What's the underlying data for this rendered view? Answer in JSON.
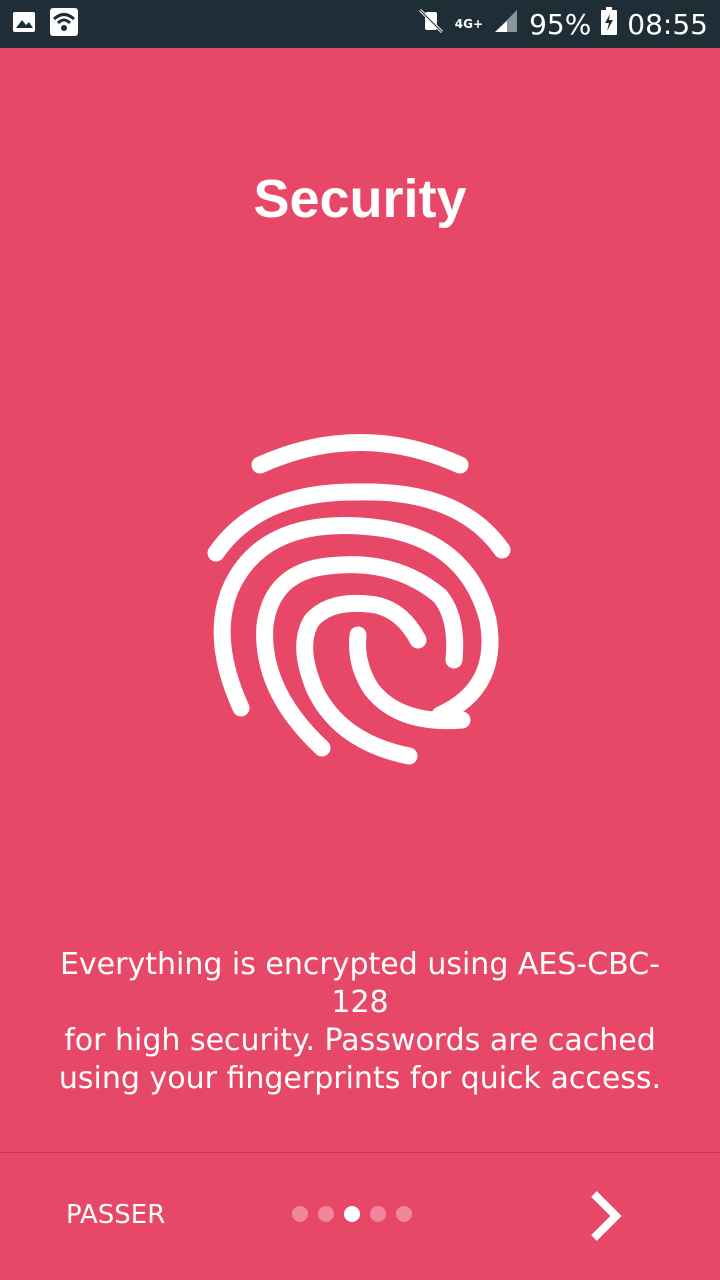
{
  "status_bar": {
    "battery_percent": "95%",
    "time": "08:55",
    "network_type": "4G+",
    "left_icons": [
      "gallery-icon",
      "wifi-icon"
    ],
    "right_icons": [
      "mute-vibrate-icon",
      "signal-icon",
      "battery-icon"
    ]
  },
  "onboarding": {
    "title": "Security",
    "illustration": "fingerprint-icon",
    "description_lines": [
      "Everything is encrypted using AES-CBC-128",
      "for high security. Passwords are cached",
      "using your fingerprints for quick access."
    ]
  },
  "footer": {
    "skip_label": "PASSER",
    "page_indicator": {
      "total": 5,
      "current": 3
    },
    "next_icon": "chevron-right-icon"
  },
  "colors": {
    "background": "#e84867",
    "status_bar": "#1f2d36",
    "foreground": "#ffffff"
  }
}
